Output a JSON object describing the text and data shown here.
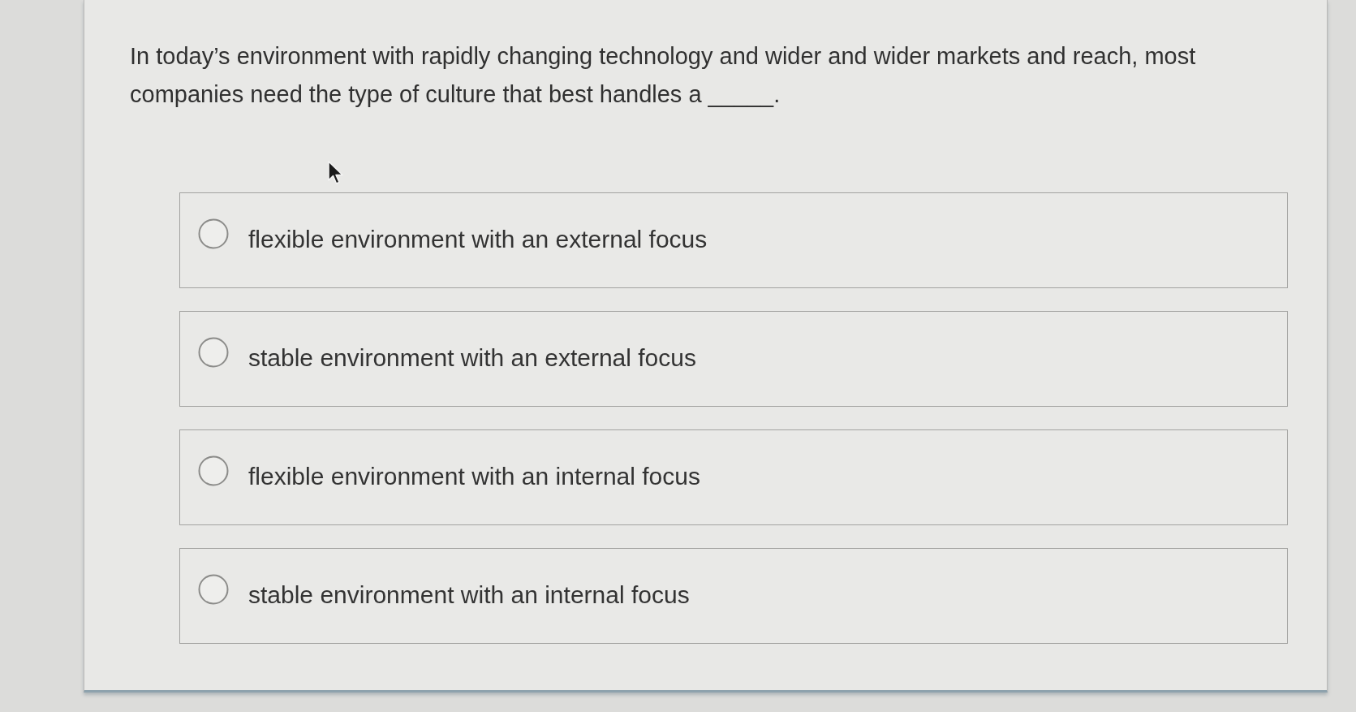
{
  "question": {
    "text": "In today’s environment with rapidly changing technology and wider and wider markets and reach, most companies need the type of culture that best handles a _____."
  },
  "options": [
    {
      "label": "flexible environment with an external focus",
      "selected": false
    },
    {
      "label": "stable environment with an external focus",
      "selected": false
    },
    {
      "label": "flexible environment with an internal focus",
      "selected": false
    },
    {
      "label": "stable environment with an internal focus",
      "selected": false
    }
  ]
}
